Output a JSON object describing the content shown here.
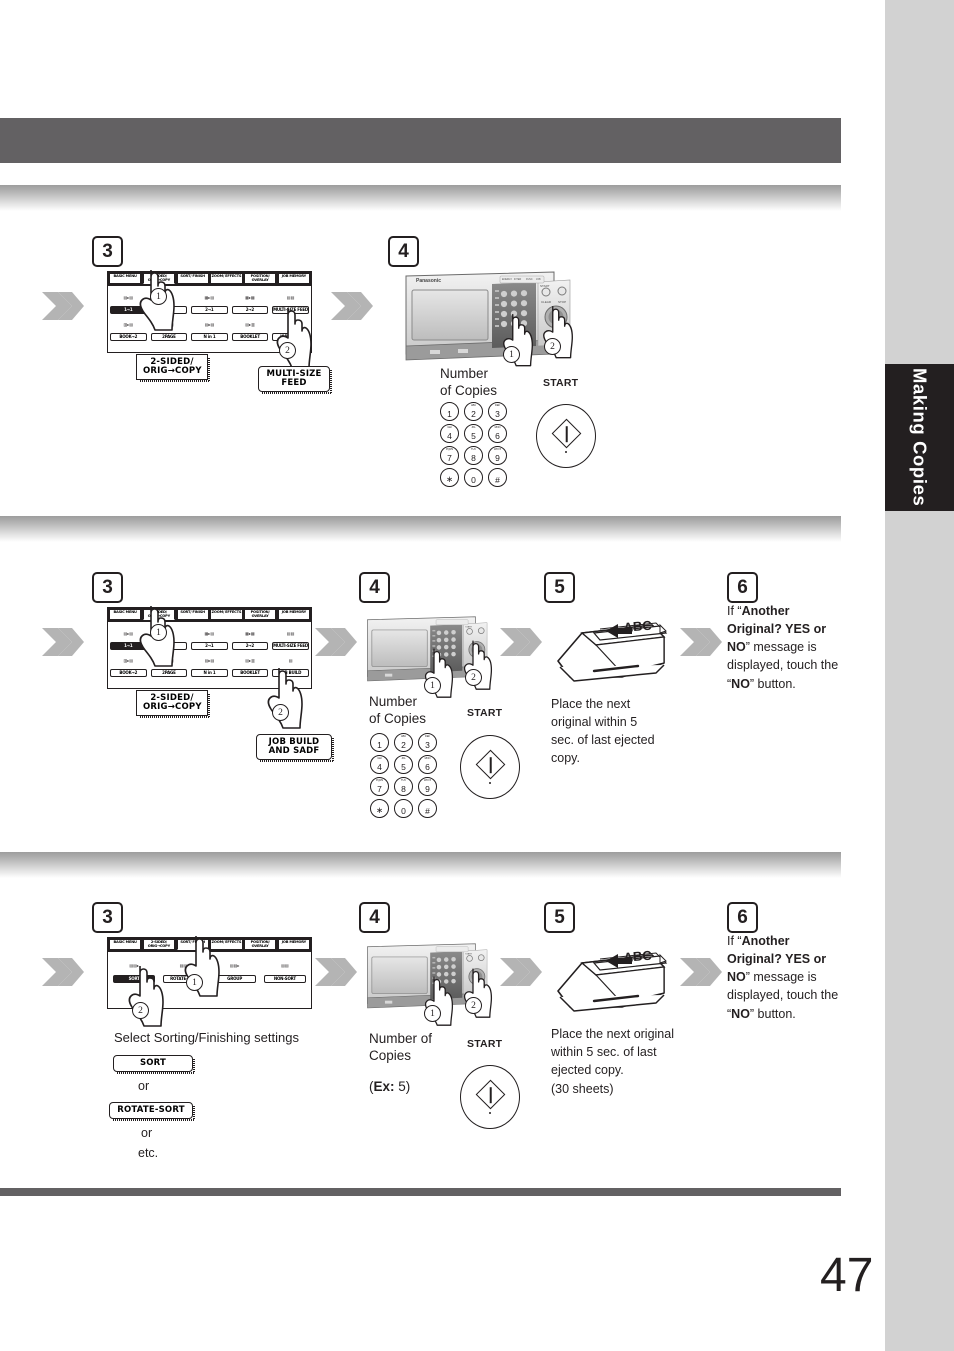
{
  "page": {
    "number": "47",
    "thumb_tab_label": "Making Copies"
  },
  "lcd_tabs": [
    "BASIC MENU",
    "2-SIDED/\nORIG→COPY",
    "SORT/\nFINISH",
    "ZOOM/\nEFFECTS",
    "POSITION/\nOVERLAY",
    "JOB\nMEMORY"
  ],
  "two_sided_panel": {
    "row1": [
      "1→1",
      "1→2",
      "2→1",
      "2→2",
      "MULTI-SIZE FEED"
    ],
    "row1_selected": "1→1",
    "row2": [
      "BOOK→2",
      "2PAGE",
      "N in 1",
      "BOOKLET",
      "JOB BUILD"
    ]
  },
  "sort_panel": {
    "buttons": [
      "SORT",
      "ROTATE-SORT",
      "GROUP",
      "NON-SORT"
    ],
    "selected": "SORT"
  },
  "sections": [
    {
      "id": "section-1",
      "steps": [
        {
          "badge": "3",
          "type": "lcd-2sided",
          "callouts": [
            "2-SIDED/\nORIG→COPY",
            "MULTI-SIZE\nFEED"
          ],
          "markers": [
            "1",
            "2"
          ]
        },
        {
          "badge": "4",
          "type": "machine-keypad",
          "label_number_of_copies": "Number\nof Copies",
          "label_start": "START",
          "markers": [
            "1",
            "2"
          ]
        }
      ]
    },
    {
      "id": "section-2",
      "steps": [
        {
          "badge": "3",
          "type": "lcd-2sided",
          "callouts": [
            "2-SIDED/\nORIG→COPY",
            "JOB BUILD\nAND SADF"
          ],
          "markers": [
            "1",
            "2"
          ]
        },
        {
          "badge": "4",
          "type": "machine-keypad",
          "label_number_of_copies": "Number\nof Copies",
          "label_start": "START",
          "markers": [
            "1",
            "2"
          ]
        },
        {
          "badge": "5",
          "type": "adf",
          "text": "Place the next original within 5 sec. of last ejected copy."
        },
        {
          "badge": "6",
          "type": "text",
          "text_parts": [
            {
              "t": "If “",
              "b": false
            },
            {
              "t": "Another Original? YES or NO",
              "b": true
            },
            {
              "t": "” message is displayed, touch the “",
              "b": false
            },
            {
              "t": "NO",
              "b": true
            },
            {
              "t": "” button.",
              "b": false
            }
          ]
        }
      ]
    },
    {
      "id": "section-3",
      "steps": [
        {
          "badge": "3",
          "type": "lcd-sort",
          "caption": "Select Sorting/Finishing settings",
          "callouts": [
            "SORT",
            "ROTATE-SORT"
          ],
          "or_label": "or",
          "etc_label": "etc.",
          "markers": [
            "1",
            "2"
          ]
        },
        {
          "badge": "4",
          "type": "machine-keypad",
          "label_number_of_copies": "Number of Copies",
          "label_example_prefix": "Ex:",
          "label_example_value": "5",
          "label_start": "START",
          "markers": [
            "1",
            "2"
          ]
        },
        {
          "badge": "5",
          "type": "adf",
          "text": "Place the next original within 5 sec. of last ejected copy.",
          "text_extra": "(30 sheets)"
        },
        {
          "badge": "6",
          "type": "text",
          "text_parts": [
            {
              "t": "If “",
              "b": false
            },
            {
              "t": "Another Original? YES or NO",
              "b": true
            },
            {
              "t": "” message is displayed, touch the “",
              "b": false
            },
            {
              "t": "NO",
              "b": true
            },
            {
              "t": "” button.",
              "b": false
            }
          ]
        }
      ]
    }
  ],
  "keypad": {
    "keys": [
      {
        "d": "1",
        "s": ""
      },
      {
        "d": "2",
        "s": "ABC"
      },
      {
        "d": "3",
        "s": "DEF"
      },
      {
        "d": "4",
        "s": "GHI"
      },
      {
        "d": "5",
        "s": "JKL"
      },
      {
        "d": "6",
        "s": "MNO"
      },
      {
        "d": "7",
        "s": "PQRS"
      },
      {
        "d": "8",
        "s": "TUV"
      },
      {
        "d": "9",
        "s": "WXYZ"
      },
      {
        "d": "∗",
        "s": ""
      },
      {
        "d": "0",
        "s": ""
      },
      {
        "d": "#",
        "s": ""
      }
    ]
  },
  "adf_label": "ABC",
  "colors": {
    "header_band": "#636163",
    "thumb_tab": "#231f20",
    "right_margin": "#d2d2d2",
    "arrow_gray": "#b4b4b4",
    "ink": "#231f20"
  }
}
